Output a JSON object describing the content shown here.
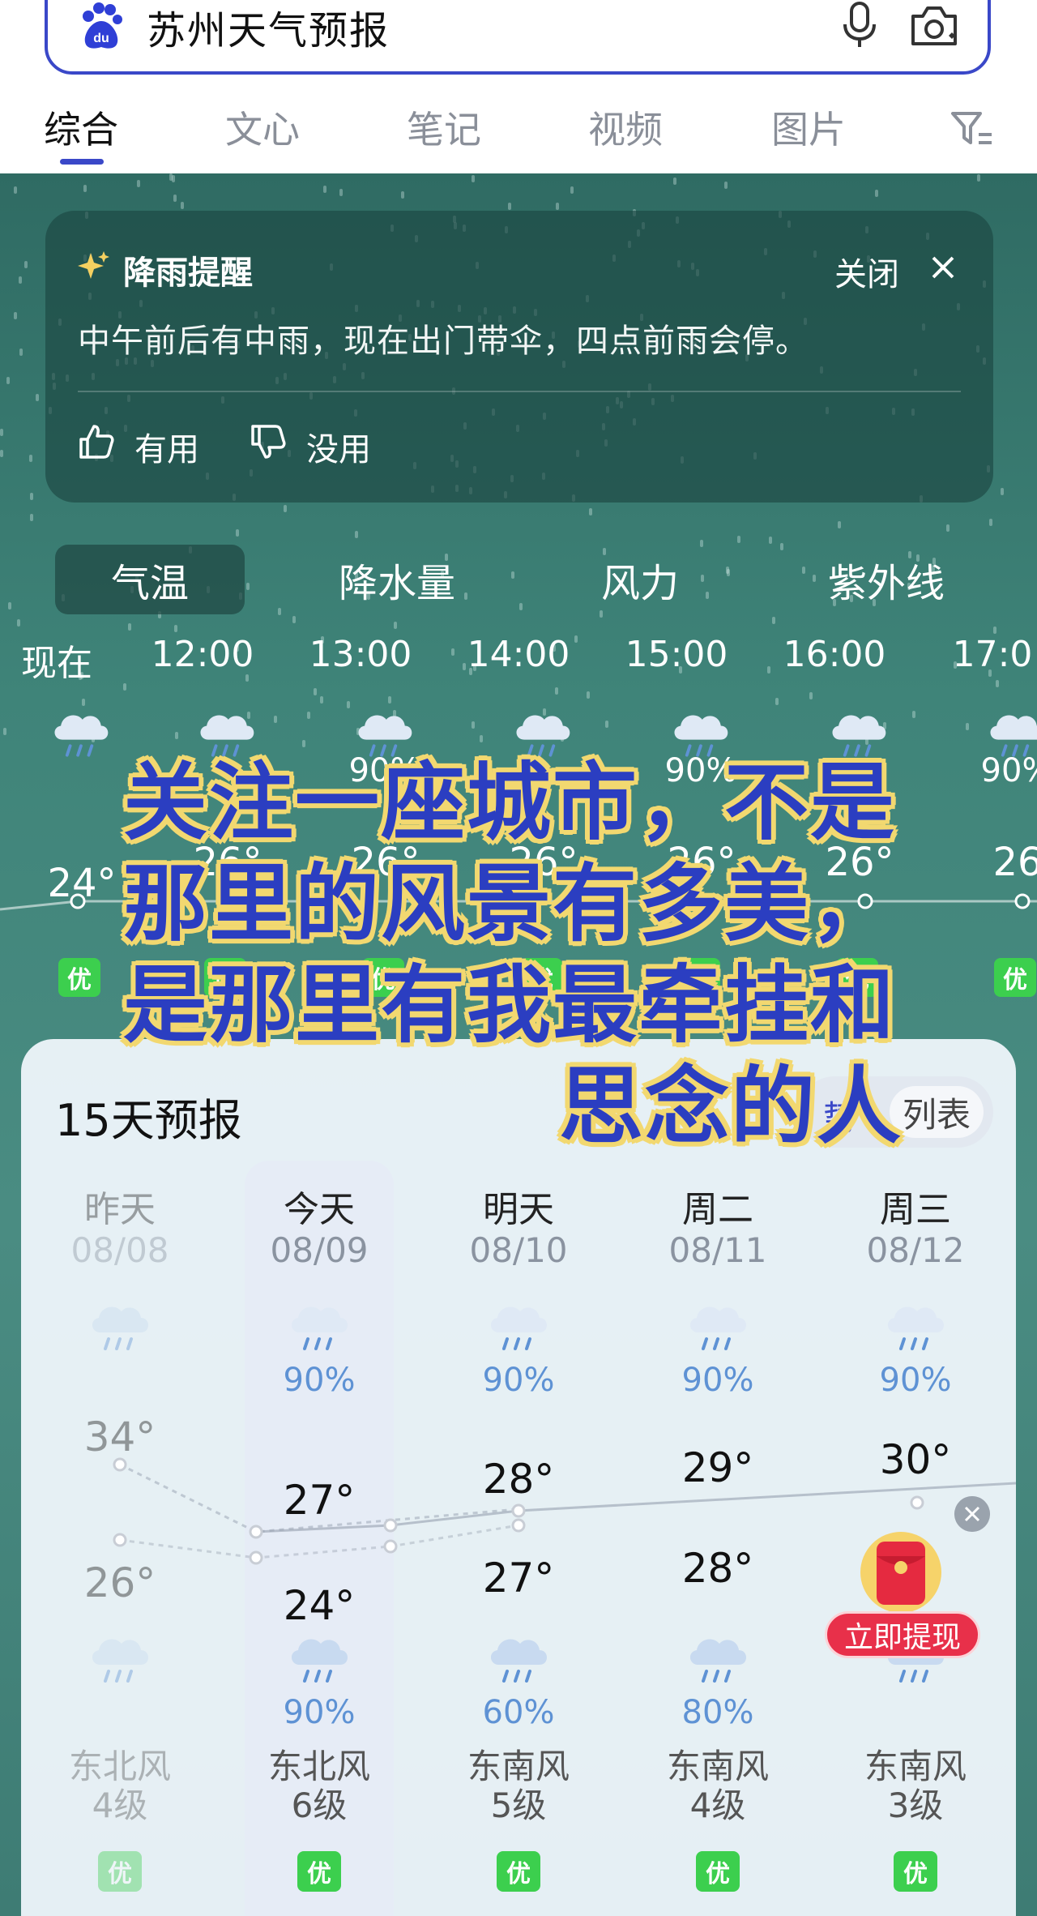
{
  "search": {
    "query": "苏州天气预报"
  },
  "tabs": [
    {
      "label": "综合"
    },
    {
      "label": "文心"
    },
    {
      "label": "笔记"
    },
    {
      "label": "视频"
    },
    {
      "label": "图片"
    }
  ],
  "alert": {
    "title": "降雨提醒",
    "close_label": "关闭",
    "body": "中午前后有中雨，现在出门带伞，四点前雨会停。",
    "useful_label": "有用",
    "useless_label": "没用"
  },
  "metric_tabs": [
    {
      "label": "气温"
    },
    {
      "label": "降水量"
    },
    {
      "label": "风力"
    },
    {
      "label": "紫外线"
    }
  ],
  "hourly": [
    {
      "time": "现在",
      "pop": "",
      "temp": "24°",
      "aqi": "优"
    },
    {
      "time": "12:00",
      "pop": "",
      "temp": "26°",
      "aqi": "优"
    },
    {
      "time": "13:00",
      "pop": "90%",
      "temp": "26°",
      "aqi": "优"
    },
    {
      "time": "14:00",
      "pop": "",
      "temp": "26°",
      "aqi": "优"
    },
    {
      "time": "15:00",
      "pop": "90%",
      "temp": "26°",
      "aqi": "优"
    },
    {
      "time": "16:00",
      "pop": "",
      "temp": "26°",
      "aqi": "优"
    },
    {
      "time": "17:0",
      "pop": "90%",
      "temp": "26",
      "aqi": "优"
    }
  ],
  "caption": {
    "line1": "关注一座城市，不是",
    "line2": "那里的风景有多美，",
    "line3": "是那里有我最牵挂和",
    "line4": "思念的人"
  },
  "forecast": {
    "title": "15天预报",
    "toggle_trend": "势",
    "toggle_list": "列表",
    "days": [
      {
        "name": "昨天",
        "date": "08/08",
        "day_pop": "",
        "high": "34°",
        "low": "26°",
        "night_pop": "",
        "wind_dir": "东北风",
        "wind_level": "4级",
        "aqi": "优"
      },
      {
        "name": "今天",
        "date": "08/09",
        "day_pop": "90%",
        "high": "27°",
        "low": "24°",
        "night_pop": "90%",
        "wind_dir": "东北风",
        "wind_level": "6级",
        "aqi": "优"
      },
      {
        "name": "明天",
        "date": "08/10",
        "day_pop": "90%",
        "high": "28°",
        "low": "27°",
        "night_pop": "60%",
        "wind_dir": "东南风",
        "wind_level": "5级",
        "aqi": "优"
      },
      {
        "name": "周二",
        "date": "08/11",
        "day_pop": "90%",
        "high": "29°",
        "low": "28°",
        "night_pop": "80%",
        "wind_dir": "东南风",
        "wind_level": "4级",
        "aqi": "优"
      },
      {
        "name": "周三",
        "date": "08/12",
        "day_pop": "90%",
        "high": "30°",
        "low": "",
        "night_pop": "",
        "wind_dir": "东南风",
        "wind_level": "3级",
        "aqi": "优"
      }
    ]
  },
  "promo": {
    "button_label": "立即提现"
  },
  "colors": {
    "brand_blue": "#3a48c8",
    "aqi_green": "#3ccf4e",
    "pop_blue": "#5e92d4",
    "promo_red": "#e8304a",
    "caption_fill": "#2b3ec1",
    "caption_stroke": "#f2d870"
  }
}
